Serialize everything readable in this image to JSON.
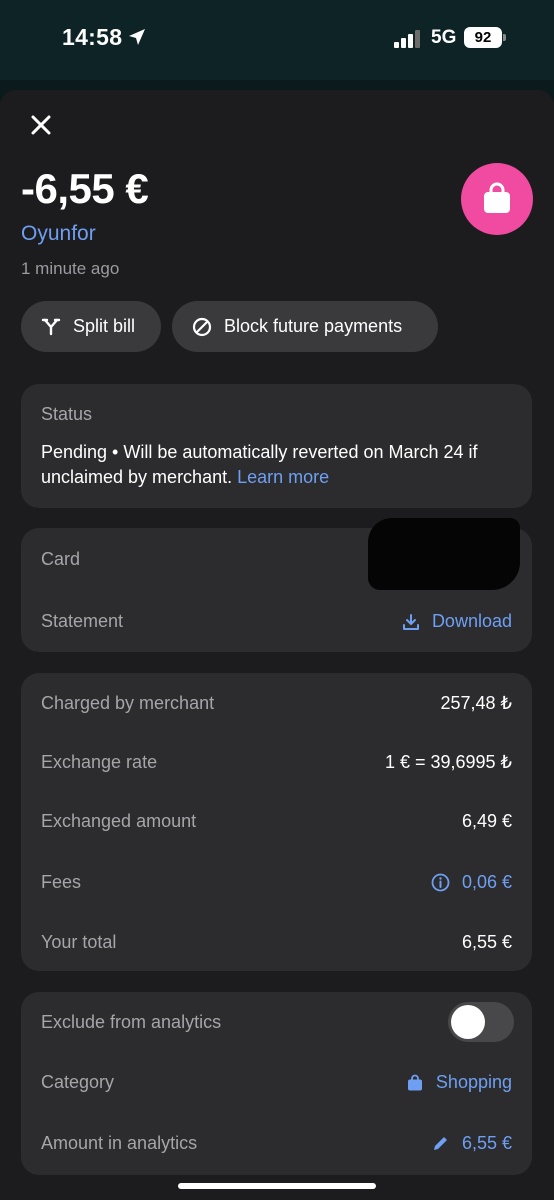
{
  "status_bar": {
    "time": "14:58",
    "network": "5G",
    "battery": "92"
  },
  "header": {
    "amount": "-6,55 €",
    "merchant": "Oyunfor",
    "time_ago": "1 minute ago",
    "logo_icon": "shopping-bag-icon",
    "logo_color": "#f04ba0"
  },
  "actions": {
    "split_label": "Split bill",
    "block_label": "Block future payments"
  },
  "status_card": {
    "label": "Status",
    "text": "Pending • Will be automatically reverted on March 24 if unclaimed by merchant.",
    "link": "Learn more"
  },
  "card_section": {
    "card_label": "Card",
    "statement_label": "Statement",
    "download_label": "Download"
  },
  "charges": {
    "rows": [
      {
        "label": "Charged by merchant",
        "value": "257,48 ₺"
      },
      {
        "label": "Exchange rate",
        "value": "1 € = 39,6995 ₺"
      },
      {
        "label": "Exchanged amount",
        "value": "6,49 €"
      },
      {
        "label": "Fees",
        "value": "0,06 €"
      },
      {
        "label": "Your total",
        "value": "6,55 €"
      }
    ]
  },
  "analytics": {
    "exclude_label": "Exclude from analytics",
    "exclude_on": false,
    "category_label": "Category",
    "category_value": "Shopping",
    "amount_label": "Amount in analytics",
    "amount_value": "6,55 €"
  },
  "colors": {
    "accent": "#6e9ff2",
    "sheet": "#1c1c1e",
    "card": "#2c2c2e"
  }
}
